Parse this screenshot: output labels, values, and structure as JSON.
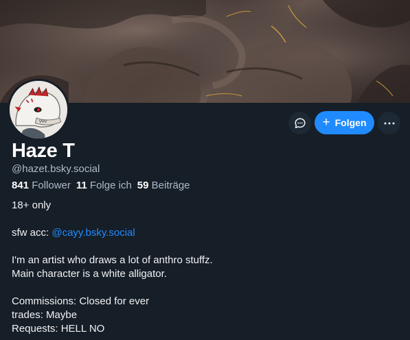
{
  "profile": {
    "display_name": "Haze T",
    "handle": "@hazet.bsky.social"
  },
  "stats": {
    "followers_count": "841",
    "followers_label": "Follower",
    "follows_count": "11",
    "follows_label": "Folge ich",
    "posts_count": "59",
    "posts_label": "Beiträge"
  },
  "actions": {
    "message_icon": "chat-bubble-icon",
    "follow_label": "Folgen",
    "follow_icon": "plus-icon",
    "more_icon": "ellipsis-icon"
  },
  "bio": {
    "line1": "18+ only",
    "sfw_prefix": "sfw acc: ",
    "sfw_link": "@cayy.bsky.social",
    "line3": "I'm an artist who draws a lot of anthro stuffz.",
    "line4": "Main character is a white alligator.",
    "line5": "Commissions: Closed for ever",
    "line6": "trades: Maybe",
    "line7": "Requests: HELL NO"
  },
  "colors": {
    "background": "#161e27",
    "accent": "#208bfe",
    "secondary_text": "#aebbc9",
    "button_dark": "#1e2936"
  }
}
